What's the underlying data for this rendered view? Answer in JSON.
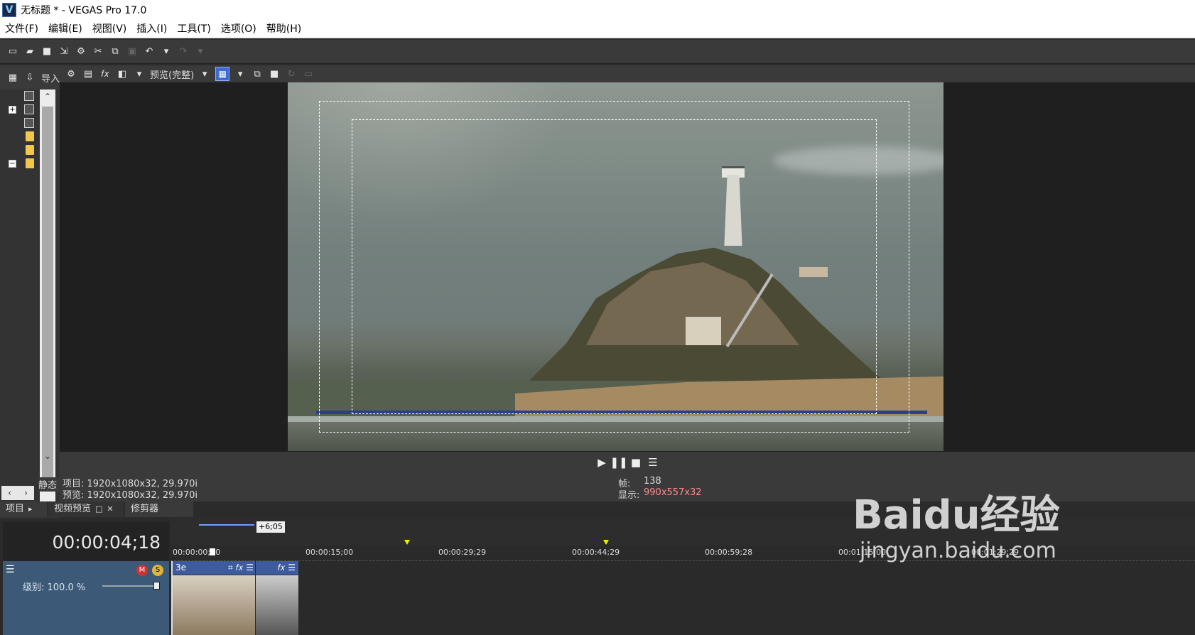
{
  "window": {
    "title": "无标题 * - VEGAS Pro 17.0",
    "logo_letter": "V"
  },
  "menu": [
    "文件(F)",
    "编辑(E)",
    "视图(V)",
    "插入(I)",
    "工具(T)",
    "选项(O)",
    "帮助(H)"
  ],
  "explorer": {
    "import_label": "导入",
    "static_label": "静态"
  },
  "preview": {
    "quality": "预览(完整)",
    "project_info": "项目: 1920x1080x32, 29.970i",
    "preview_info": "预览: 1920x1080x32, 29.970i",
    "frame_label": "帧:",
    "frame_value": "138",
    "display_label": "显示:",
    "display_value": "990x557x32"
  },
  "tabs": {
    "project": "项目",
    "video_preview": "视频预览",
    "trimmer": "修剪器"
  },
  "timeline": {
    "timecode": "00:00:04;18",
    "loop_length": "+6;05",
    "ruler_ticks": [
      "00:00:00;00",
      "00:00:15;00",
      "00:00:29;29",
      "00:00:44;29",
      "00:00:59;28",
      "00:01:15;00",
      "00:01:29;29"
    ],
    "track_level": "级别: 100.0 %",
    "event1_label": "3e"
  },
  "watermark": {
    "brand": "Baidu经验",
    "url": "jingyan.baidu.com"
  }
}
